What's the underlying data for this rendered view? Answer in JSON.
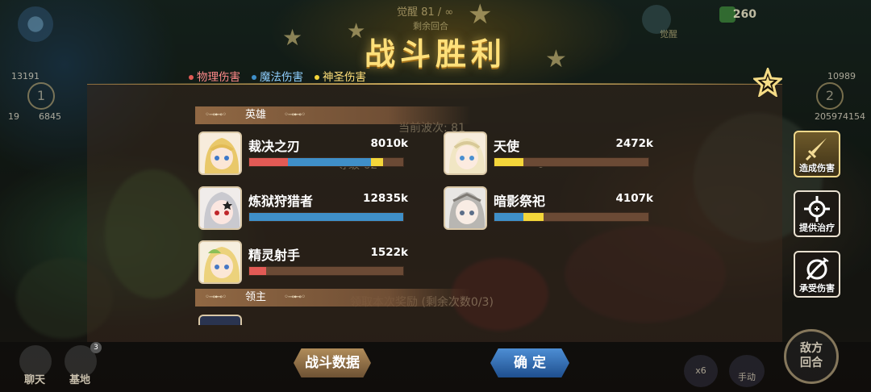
{
  "top": {
    "awaken_text": "觉醒 81 / ∞",
    "remaining_rounds": "剩余回合",
    "gem_count": "260",
    "left_power": "13191",
    "right_power": "10989",
    "left_circle": "1",
    "right_circle": "2",
    "left_sub": "19",
    "left_hp": "6845",
    "right_hp": "205974154",
    "awaken_icon_label": "觉醒"
  },
  "title": "战斗胜利",
  "legend": {
    "physical": "物理伤害",
    "magic": "魔法伤害",
    "holy": "神圣伤害"
  },
  "colors": {
    "physical": "#e25a55",
    "magic": "#3f8fc8",
    "holy": "#f4d63a",
    "title": "#ffe07a"
  },
  "background_texts": {
    "wave": "当前波次: 81",
    "level": "等级 62",
    "zero": "0",
    "claim": "领取本次奖励 (剩余次数0/3)"
  },
  "sections": {
    "heroes": "英雄",
    "lord": "领主"
  },
  "heroes": [
    {
      "name": "裁决之刃",
      "value": "8010k",
      "fill": {
        "physical": 0.25,
        "magic": 0.54,
        "holy": 0.08
      }
    },
    {
      "name": "天使",
      "value": "2472k",
      "fill": {
        "physical": 0,
        "magic": 0,
        "holy": 0.19
      }
    },
    {
      "name": "炼狱狩猎者",
      "value": "12835k",
      "fill": {
        "physical": 0,
        "magic": 1.0,
        "holy": 0
      }
    },
    {
      "name": "暗影祭祀",
      "value": "4107k",
      "fill": {
        "physical": 0,
        "magic": 0.19,
        "holy": 0.13
      }
    },
    {
      "name": "精灵射手",
      "value": "1522k",
      "fill": {
        "physical": 0.11,
        "magic": 0,
        "holy": 0
      }
    }
  ],
  "side_buttons": {
    "deal": "造成伤害",
    "heal": "提供治疗",
    "take": "承受伤害"
  },
  "bottom": {
    "chat": "聊天",
    "base": "基地",
    "base_badge": "3",
    "stats_button": "战斗数据",
    "ok_button": "确 定",
    "speed": "x6",
    "manual": "手动",
    "enemy_turn_1": "敌方",
    "enemy_turn_2": "回合"
  }
}
